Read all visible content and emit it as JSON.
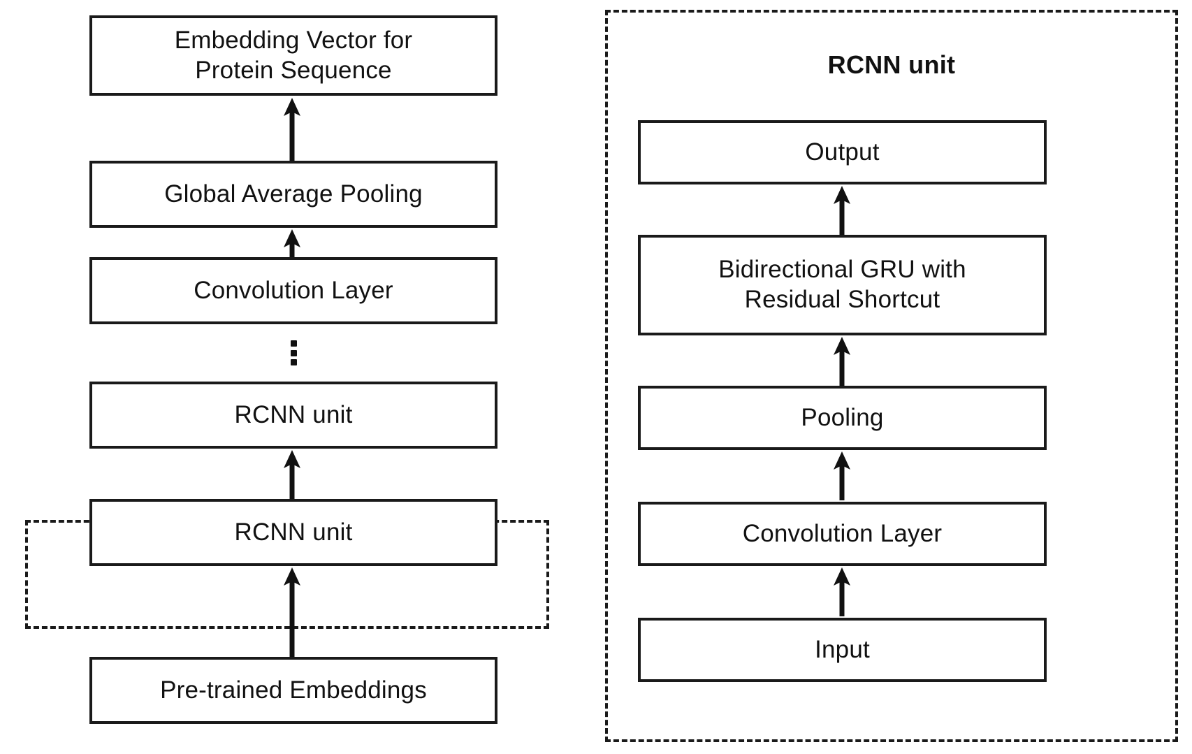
{
  "figure": {
    "type": "architecture-block-diagram",
    "background_color": "#ffffff",
    "stroke_color": "#1a1a1a",
    "text_color": "#111111"
  },
  "left_panel": {
    "name": "protein-sequence-embedding-pipeline",
    "flow_direction": "bottom-to-top",
    "blocks": [
      {
        "id": "embedding-vector",
        "label": "Embedding Vector for\nProtein Sequence"
      },
      {
        "id": "global-average-pooling",
        "label": "Global Average Pooling"
      },
      {
        "id": "convolution-layer",
        "label": "Convolution Layer"
      },
      {
        "id": "rcnn-unit-upper",
        "label": "RCNN unit"
      },
      {
        "id": "rcnn-unit-lower",
        "label": "RCNN unit"
      },
      {
        "id": "pre-trained-embeddings",
        "label": "Pre-trained Embeddings"
      }
    ],
    "ellipsis_marker": "⋮",
    "highlight_region": {
      "id": "rcnn-unit-highlight",
      "style": "dashed",
      "encloses": "rcnn-unit-lower"
    }
  },
  "right_panel": {
    "name": "rcnn-unit-detail",
    "title": "RCNN unit",
    "style": "dashed",
    "flow_direction": "bottom-to-top",
    "blocks": [
      {
        "id": "output",
        "label": "Output"
      },
      {
        "id": "bidirectional-gru",
        "label": "Bidirectional GRU with\nResidual Shortcut"
      },
      {
        "id": "pooling",
        "label": "Pooling"
      },
      {
        "id": "convolution-layer",
        "label": "Convolution Layer"
      },
      {
        "id": "input",
        "label": "Input"
      }
    ]
  }
}
